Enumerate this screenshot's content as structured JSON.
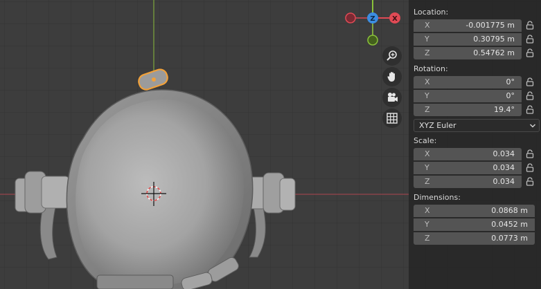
{
  "gizmo": {
    "z_label": "Z",
    "x_label": "X"
  },
  "colors": {
    "x_axis": "#e04a55",
    "y_axis": "#8ac23a",
    "z_axis": "#3c8de0",
    "selection": "#f1a13a"
  },
  "nav_icons": [
    "zoom-icon",
    "hand-icon",
    "camera-icon",
    "grid-icon"
  ],
  "panel": {
    "location": {
      "label": "Location:",
      "fields": [
        {
          "axis": "X",
          "value": "-0.001775 m"
        },
        {
          "axis": "Y",
          "value": "0.30795 m"
        },
        {
          "axis": "Z",
          "value": "0.54762 m"
        }
      ]
    },
    "rotation": {
      "label": "Rotation:",
      "fields": [
        {
          "axis": "X",
          "value": "0°"
        },
        {
          "axis": "Y",
          "value": "0°"
        },
        {
          "axis": "Z",
          "value": "19.4°"
        }
      ],
      "mode": "XYZ Euler"
    },
    "scale": {
      "label": "Scale:",
      "fields": [
        {
          "axis": "X",
          "value": "0.034"
        },
        {
          "axis": "Y",
          "value": "0.034"
        },
        {
          "axis": "Z",
          "value": "0.034"
        }
      ]
    },
    "dimensions": {
      "label": "Dimensions:",
      "fields": [
        {
          "axis": "X",
          "value": "0.0868 m"
        },
        {
          "axis": "Y",
          "value": "0.0452 m"
        },
        {
          "axis": "Z",
          "value": "0.0773 m"
        }
      ]
    }
  }
}
